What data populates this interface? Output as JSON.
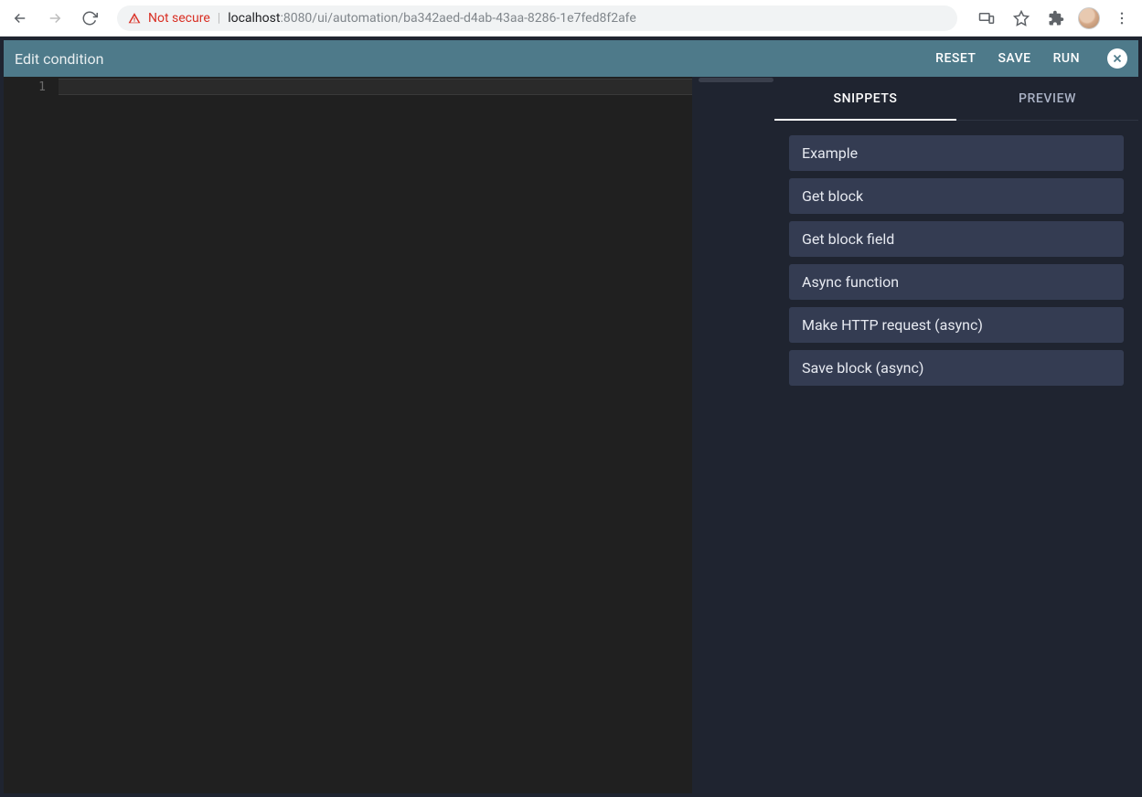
{
  "browser": {
    "not_secure_label": "Not secure",
    "url_host": "localhost",
    "url_port_path": ":8080/ui/automation/ba342aed-d4ab-43aa-8286-1e7fed8f2afe"
  },
  "header": {
    "title": "Edit condition",
    "reset_label": "RESET",
    "save_label": "SAVE",
    "run_label": "RUN"
  },
  "editor": {
    "line_number": "1",
    "content": ""
  },
  "tabs": {
    "snippets_label": "SNIPPETS",
    "preview_label": "PREVIEW"
  },
  "snippets": [
    "Example",
    "Get block",
    "Get block field",
    "Async function",
    "Make HTTP request (async)",
    "Save block (async)"
  ]
}
